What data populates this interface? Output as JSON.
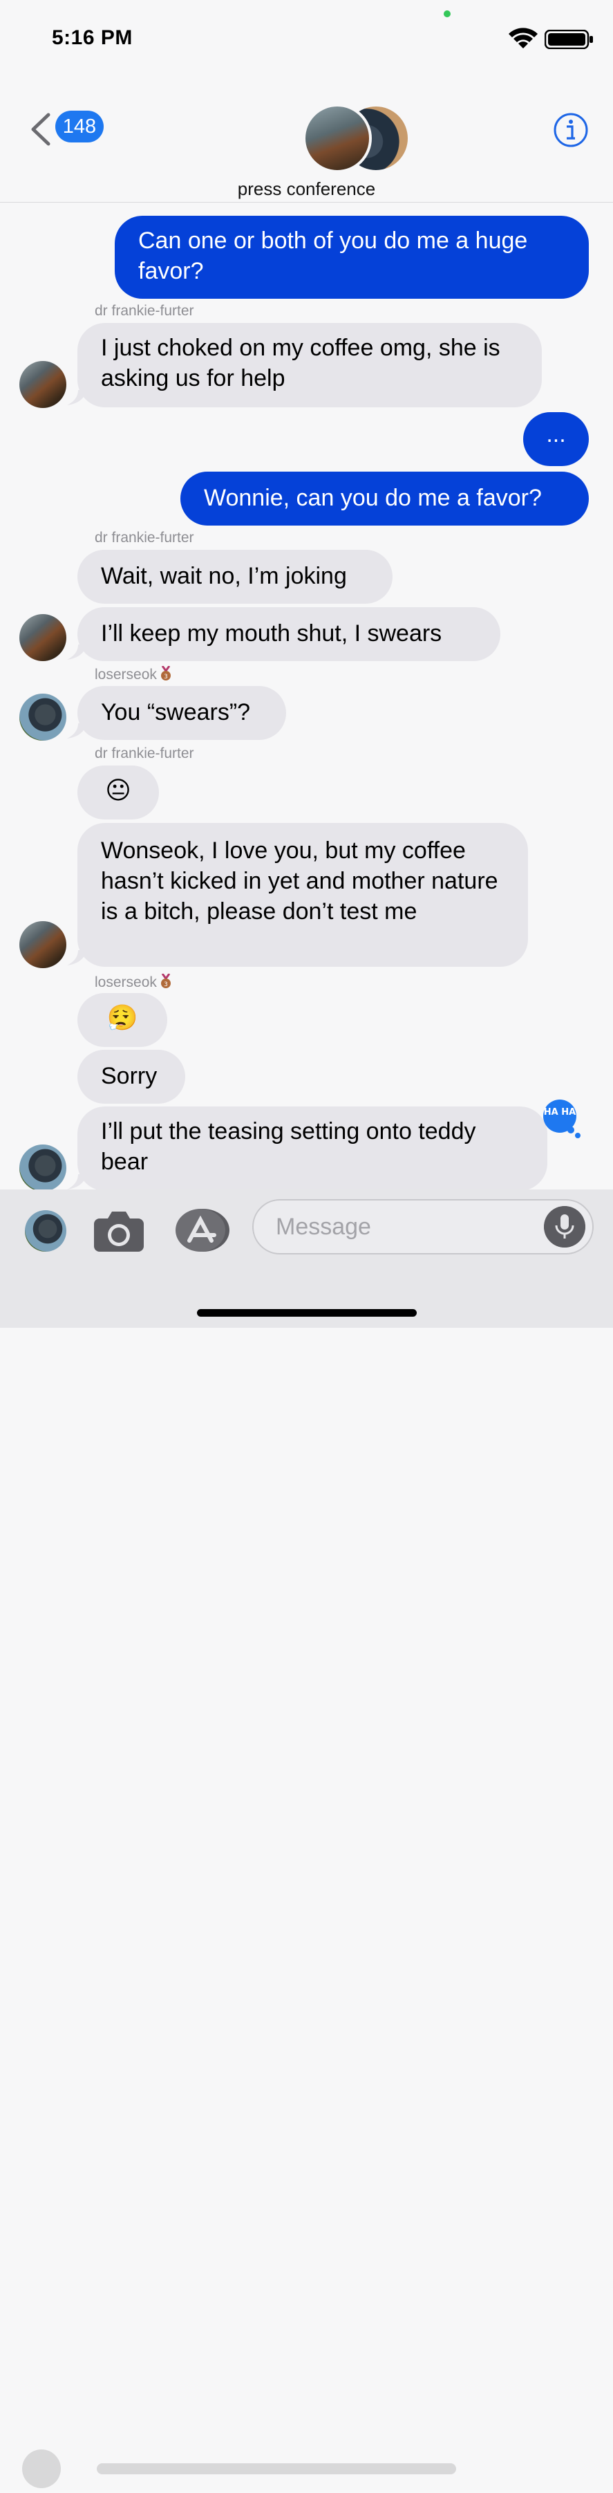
{
  "status_bar": {
    "time": "5:16 PM"
  },
  "header": {
    "back_count": "148",
    "group_name": "press conference"
  },
  "messages": {
    "m1": "Can one or both of you do me a huge favor?",
    "s1": "dr frankie-furter",
    "m2": "I just choked on my coffee omg, she is asking us for help",
    "m3": "...",
    "m4": "Wonnie, can you do me a favor?",
    "s2": "dr frankie-furter",
    "m5": "Wait, wait no, I’m joking",
    "m6": "I’ll keep my mouth shut, I swears",
    "s3": "loserseok",
    "m7": "You “swears”?",
    "s4": "dr frankie-furter",
    "m8": "😐",
    "m9": "Wonseok, I love you, but my coffee hasn’t kicked in yet and mother nature is a bitch, please don’t test me",
    "s5": "loserseok",
    "m10": "😮‍💨",
    "m11": "Sorry",
    "m12": "I’ll put the teasing setting onto teddy bear"
  },
  "reaction": {
    "label": "HA HA"
  },
  "input": {
    "placeholder": "Message"
  },
  "colors": {
    "sent_bubble": "#0541d8",
    "received_bubble": "#e6e5ea",
    "accent": "#1e78f0"
  }
}
